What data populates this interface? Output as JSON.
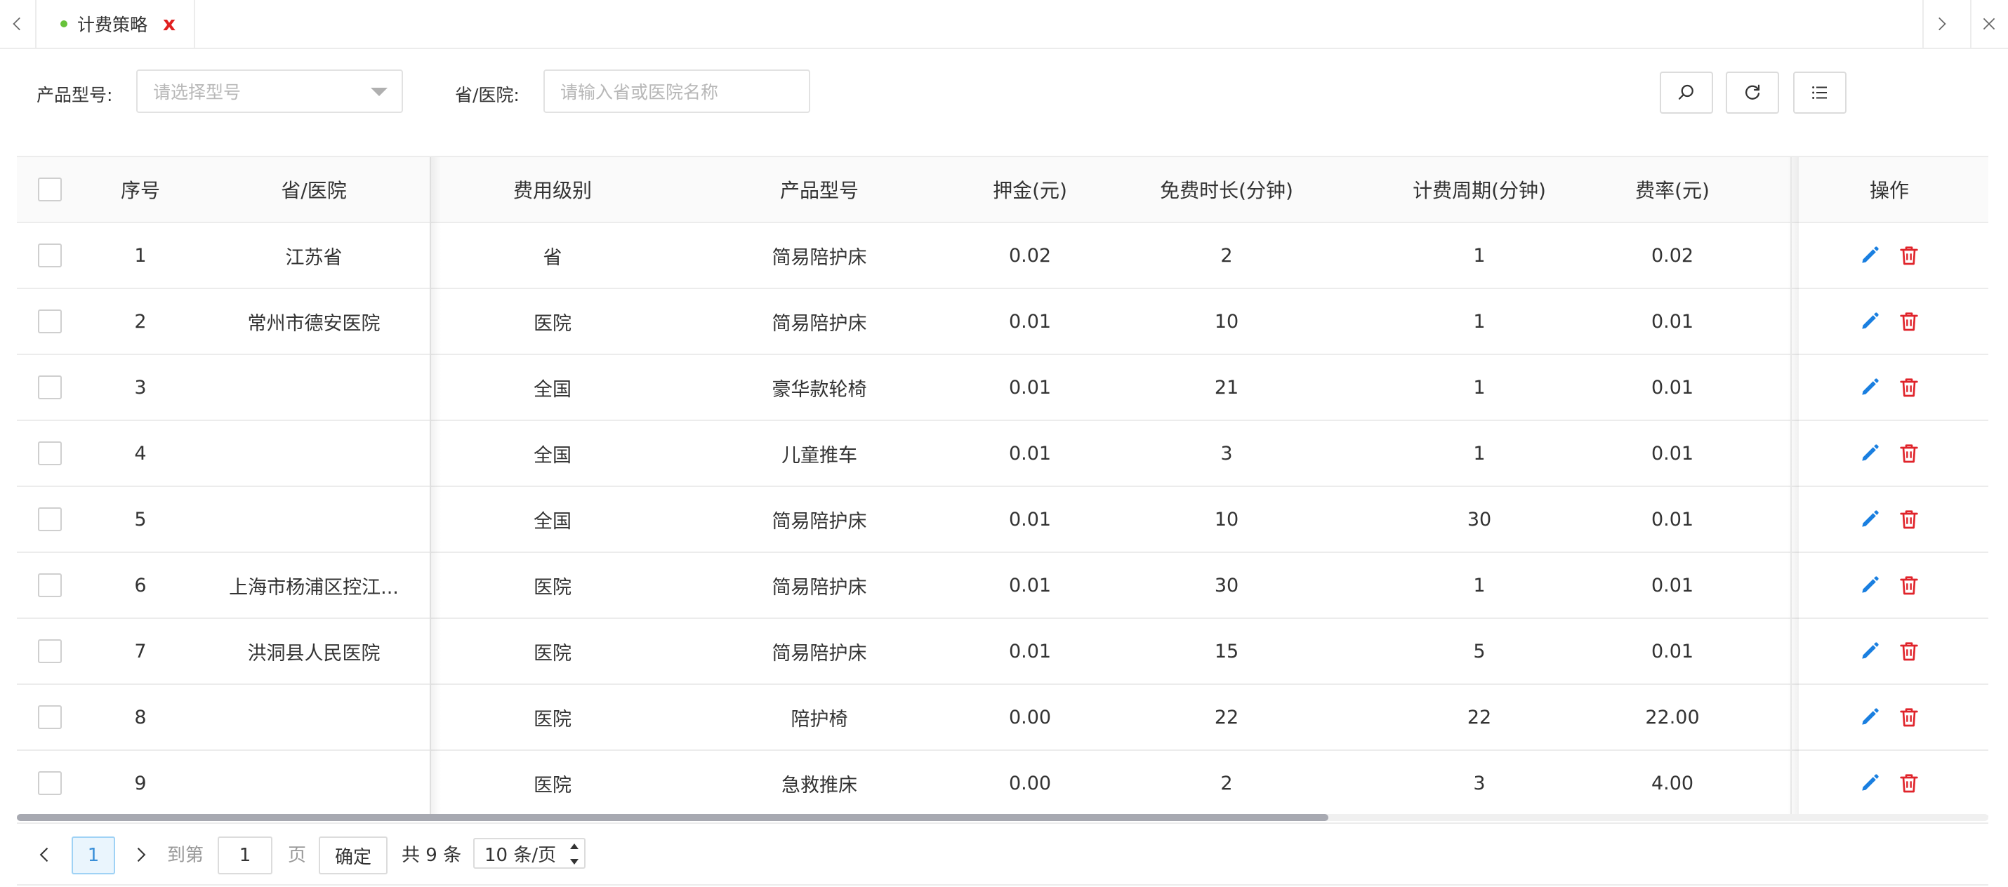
{
  "tabbar": {
    "tabs": [
      {
        "label": "计费策略",
        "active": true,
        "status_color": "#67c23a"
      }
    ],
    "close_mark": "x",
    "icons": {
      "prev": "chevron-left-icon",
      "next": "chevron-right-icon",
      "close_all": "close-icon"
    }
  },
  "filters": {
    "product_model": {
      "label": "产品型号:",
      "placeholder": "请选择型号",
      "value": ""
    },
    "province_hospital": {
      "label": "省/医院:",
      "placeholder": "请输入省或医院名称",
      "value": ""
    }
  },
  "toolbar": {
    "icons": [
      "search-icon",
      "refresh-icon",
      "list-icon"
    ]
  },
  "table": {
    "columns": [
      "序号",
      "省/医院",
      "费用级别",
      "产品型号",
      "押金(元)",
      "免费时长(分钟)",
      "计费周期(分钟)",
      "费率(元)",
      "操作"
    ],
    "rows": [
      [
        "1",
        "江苏省",
        "省",
        "简易陪护床",
        "0.02",
        "2",
        "1",
        "0.02"
      ],
      [
        "2",
        "常州市德安医院",
        "医院",
        "简易陪护床",
        "0.01",
        "10",
        "1",
        "0.01"
      ],
      [
        "3",
        "",
        "全国",
        "豪华款轮椅",
        "0.01",
        "21",
        "1",
        "0.01"
      ],
      [
        "4",
        "",
        "全国",
        "儿童推车",
        "0.01",
        "3",
        "1",
        "0.01"
      ],
      [
        "5",
        "",
        "全国",
        "简易陪护床",
        "0.01",
        "10",
        "30",
        "0.01"
      ],
      [
        "6",
        "上海市杨浦区控江...",
        "医院",
        "简易陪护床",
        "0.01",
        "30",
        "1",
        "0.01"
      ],
      [
        "7",
        "洪洞县人民医院",
        "医院",
        "简易陪护床",
        "0.01",
        "15",
        "5",
        "0.01"
      ],
      [
        "8",
        "",
        "医院",
        "陪护椅",
        "0.00",
        "22",
        "22",
        "22.00"
      ],
      [
        "9",
        "",
        "医院",
        "急救推床",
        "0.00",
        "2",
        "3",
        "4.00"
      ]
    ],
    "row_action_icons": [
      "edit-icon",
      "delete-icon"
    ],
    "colors": {
      "edit": "#1a7fe0",
      "delete": "#e0242b"
    }
  },
  "pagination": {
    "current_page": "1",
    "goto_prefix": "到第",
    "goto_value": "1",
    "goto_suffix": "页",
    "confirm_label": "确定",
    "total_text": "共 9 条",
    "page_size": "10 条/页",
    "colors": {
      "active_border": "#9fd2f5",
      "active_bg": "#eaf5fd",
      "active_text": "#3a8fd8"
    }
  }
}
